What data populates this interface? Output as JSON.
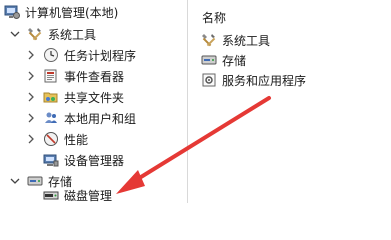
{
  "tree": {
    "root_label": "计算机管理(本地)",
    "system_tools": {
      "label": "系统工具",
      "children": [
        {
          "label": "任务计划程序",
          "icon": "clock-icon"
        },
        {
          "label": "事件查看器",
          "icon": "event-viewer-icon"
        },
        {
          "label": "共享文件夹",
          "icon": "shared-folder-icon"
        },
        {
          "label": "本地用户和组",
          "icon": "users-icon"
        },
        {
          "label": "性能",
          "icon": "performance-icon"
        },
        {
          "label": "设备管理器",
          "icon": "device-manager-icon"
        }
      ]
    },
    "storage": {
      "label": "存储",
      "children": [
        {
          "label": "磁盘管理",
          "icon": "disk-management-icon"
        }
      ]
    }
  },
  "list": {
    "header": "名称",
    "items": [
      {
        "label": "系统工具",
        "icon": "tools-icon"
      },
      {
        "label": "存储",
        "icon": "storage-icon"
      },
      {
        "label": "服务和应用程序",
        "icon": "services-icon"
      }
    ]
  },
  "colors": {
    "arrow": "#e53935"
  }
}
